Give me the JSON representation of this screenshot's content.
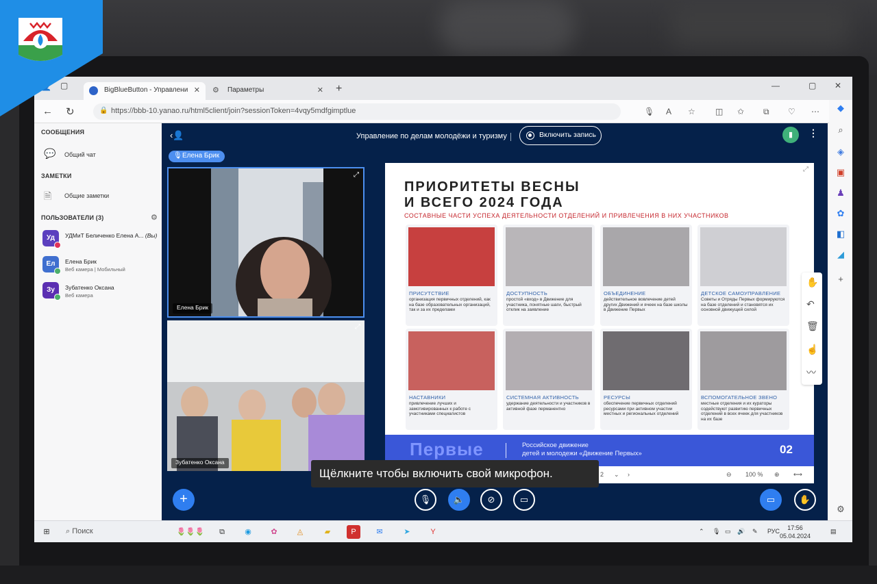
{
  "browser": {
    "tabs": [
      {
        "label": "BigBlueButton - Управлени"
      },
      {
        "label": "Параметры"
      }
    ],
    "new_tab": "+",
    "url": "https://bbb-10.yanao.ru/html5client/join?sessionToken=4vqy5mdfgimptlue"
  },
  "left_panel": {
    "messages_header": "СООБЩЕНИЯ",
    "public_chat": "Общий чат",
    "notes_header": "ЗАМЕТКИ",
    "shared_notes": "Общие заметки",
    "users_header": "ПОЛЬЗОВАТЕЛИ (3)",
    "users": [
      {
        "initials": "Уд",
        "name": "УДМиТ Беличенко Елена А...",
        "suffix": "(Вы)",
        "sub": "",
        "color": "#5b3fbf",
        "dot_color": "#e0335a"
      },
      {
        "initials": "Ел",
        "name": "Елена Брик",
        "suffix": "",
        "sub": "Веб камера | Мобильный",
        "color": "#3f6fcf",
        "dot_color": "#4cae6a"
      },
      {
        "initials": "Зу",
        "name": "Зубатенко Оксана",
        "suffix": "",
        "sub": "Веб камера",
        "color": "#5b2fb2",
        "dot_color": "#4cae6a"
      }
    ]
  },
  "meeting": {
    "title": "Управление по делам молодёжи и туризму",
    "record_label": "Включить запись",
    "talking": "Елена Брик",
    "videos": [
      {
        "name": "Елена Брик"
      },
      {
        "name": "Зубатенко Оксана"
      }
    ],
    "tooltip": "Щёлкните  чтобы включить свой микрофон."
  },
  "slide": {
    "title_line1": "ПРИОРИТЕТЫ ВЕСНЫ",
    "title_line2": "И ВСЕГО 2024 ГОДА",
    "subtitle": "СОСТАВНЫЕ ЧАСТИ УСПЕХА ДЕЯТЕЛЬНОСТИ ОТДЕЛЕНИЙ И ПРИВЛЕЧЕНИЯ В НИХ УЧАСТНИКОВ",
    "cards": [
      {
        "title": "ПРИСУТСТВИЕ",
        "desc": "организация первичных отделений, как на базе образовательных организаций, так и за их пределами"
      },
      {
        "title": "ДОСТУПНОСТЬ",
        "desc": "простой «вход» в Движение для участника, понятные шаги, быстрый отклик на заявление"
      },
      {
        "title": "ОБЪЕДИНЕНИЕ",
        "desc": "действительное вовлечение детей других Движений и ячеек на базе школы в Движение Первых"
      },
      {
        "title": "ДЕТСКОЕ САМОУПРАВЛЕНИЕ",
        "desc": "Советы и Отряды Первых формируются на базе отделений и становятся их основной движущей силой"
      },
      {
        "title": "НАСТАВНИКИ",
        "desc": "привлечение лучших и замотивированных к работе с участниками специалистов"
      },
      {
        "title": "СИСТЕМНАЯ АКТИВНОСТЬ",
        "desc": "удержание деятельности и участников в активной фазе перманентно"
      },
      {
        "title": "РЕСУРСЫ",
        "desc": "обеспечение первичных отделений ресурсами при активном участии местных и региональных отделений"
      },
      {
        "title": "ВСПОМОГАТЕЛЬНОЕ ЗВЕНО",
        "desc": "местные отделения и их кураторы содействуют развитию первичных отделений в всех ячеек для участников на их базе"
      }
    ],
    "banner_word": "Первые",
    "banner_text_1": "Российское движение",
    "banner_text_2": "детей и молодежи «Движение Первых»",
    "page_number": "02",
    "current_slide": "2",
    "zoom": "100 %"
  },
  "taskbar": {
    "search": "Поиск",
    "lang": "РУС",
    "time": "17:56",
    "date": "05.04.2024"
  },
  "colors": {
    "meeting_bg": "#05214a",
    "accent_blue": "#2f7ef0",
    "slide_red": "#c5262d",
    "banner_blue": "#3a57d8"
  }
}
